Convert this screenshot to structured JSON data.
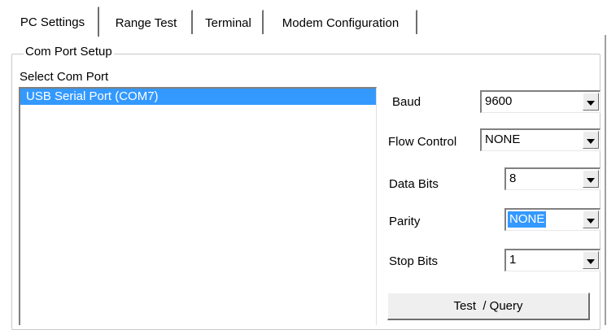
{
  "tabs": [
    {
      "label": "PC Settings",
      "active": true
    },
    {
      "label": "Range Test",
      "active": false
    },
    {
      "label": "Terminal",
      "active": false
    },
    {
      "label": "Modem Configuration",
      "active": false
    }
  ],
  "group": {
    "title": "Com Port Setup",
    "select_label": "Select Com Port",
    "ports": [
      "USB Serial Port (COM7)"
    ]
  },
  "settings": {
    "baud": {
      "label": "Baud",
      "value": "9600"
    },
    "flow_control": {
      "label": "Flow Control",
      "value": "NONE"
    },
    "data_bits": {
      "label": "Data Bits",
      "value": "8"
    },
    "parity": {
      "label": "Parity",
      "value": "NONE"
    },
    "stop_bits": {
      "label": "Stop Bits",
      "value": "1"
    }
  },
  "actions": {
    "test_query": "Test  / Query"
  },
  "icons": {
    "dropdown": "chevron-down-icon"
  },
  "colors": {
    "selection": "#3399ff",
    "face": "#efefef",
    "shadow": "#6e6e6e"
  }
}
